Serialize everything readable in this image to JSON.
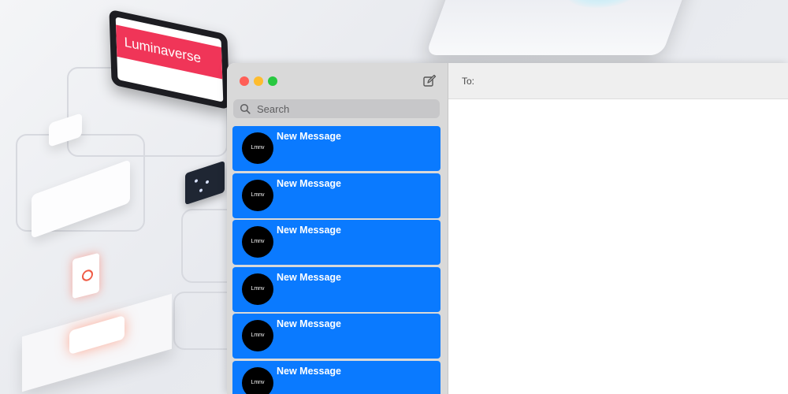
{
  "wallpaper": {
    "tablet_text": "Luminaverse",
    "accent": "#f03558"
  },
  "window": {
    "traffic_lights": [
      "#ff5f57",
      "#febc2e",
      "#28c840"
    ],
    "compose_icon": "compose-icon"
  },
  "search": {
    "placeholder": "Search",
    "icon": "search-icon"
  },
  "conversations": [
    {
      "avatar": "Lmnv",
      "title": "New Message"
    },
    {
      "avatar": "Lmnv",
      "title": "New Message"
    },
    {
      "avatar": "Lmnv",
      "title": "New Message"
    },
    {
      "avatar": "Lmnv",
      "title": "New Message"
    },
    {
      "avatar": "Lmnv",
      "title": "New Message"
    },
    {
      "avatar": "Lmnv",
      "title": "New Message"
    }
  ],
  "selection_color": "#0a7aff",
  "compose": {
    "to_label": "To:",
    "to_value": ""
  }
}
